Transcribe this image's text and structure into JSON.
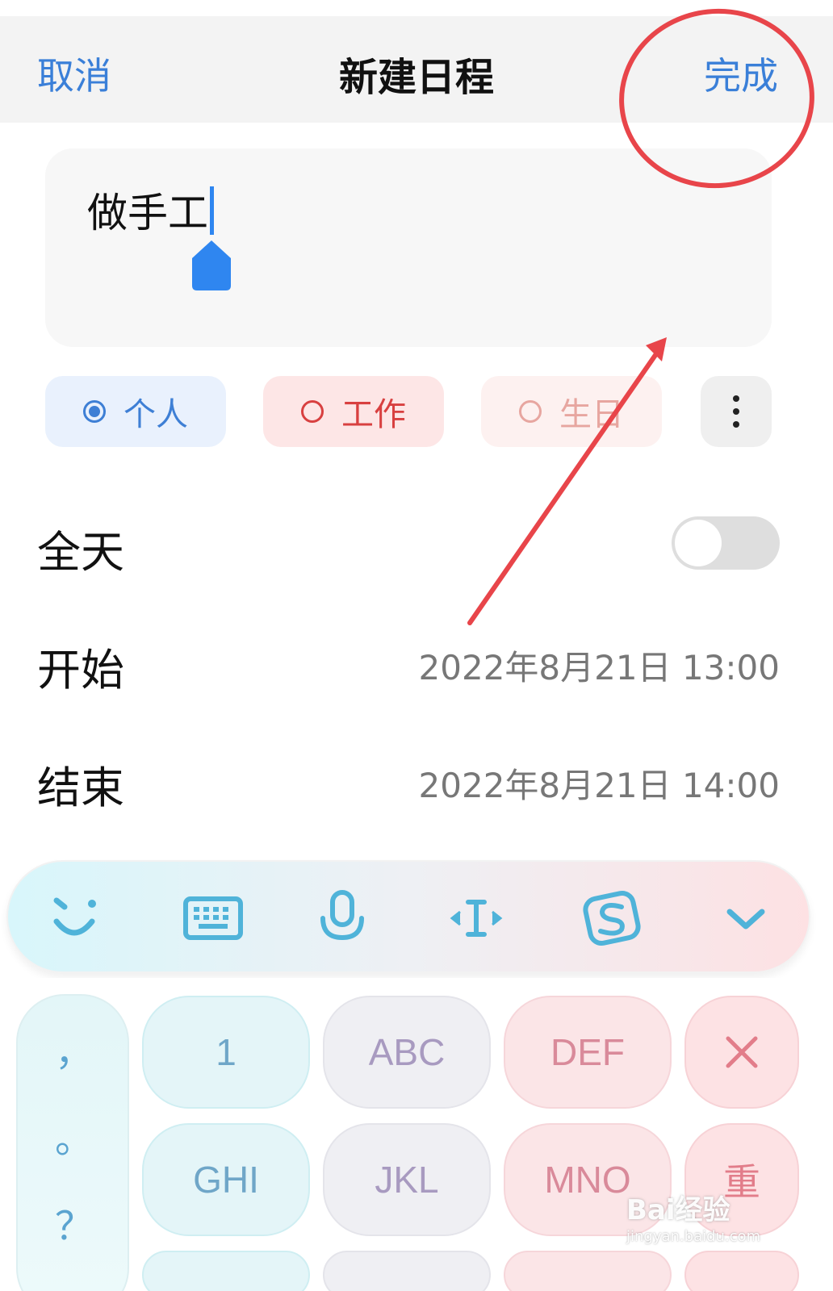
{
  "navbar": {
    "cancel_label": "取消",
    "title": "新建日程",
    "done_label": "完成"
  },
  "event_title": {
    "value": "做手工"
  },
  "categories": [
    {
      "label": "个人",
      "selected": true,
      "color": "#3e7fd5"
    },
    {
      "label": "工作",
      "selected": false,
      "color": "#d84040"
    },
    {
      "label": "生日",
      "selected": false,
      "color": "#e7a6a0"
    }
  ],
  "all_day": {
    "label": "全天",
    "enabled": false
  },
  "start": {
    "label": "开始",
    "value": "2022年8月21日 13:00"
  },
  "end": {
    "label": "结束",
    "value": "2022年8月21日 14:00"
  },
  "keyboard": {
    "toolbar_icons": [
      "emoji-icon",
      "keyboard-icon",
      "microphone-icon",
      "cursor-icon",
      "sogou-logo-icon",
      "collapse-icon"
    ],
    "symbols": [
      "，",
      "。",
      "？"
    ],
    "rows": [
      [
        "1",
        "ABC",
        "DEF",
        "×"
      ],
      [
        "GHI",
        "JKL",
        "MNO",
        "重"
      ]
    ]
  },
  "watermark": {
    "brand": "Bai经验",
    "url": "jingyan.baidu.com"
  },
  "colors": {
    "accent": "#3a7fd8",
    "annotation": "#e8454a"
  }
}
